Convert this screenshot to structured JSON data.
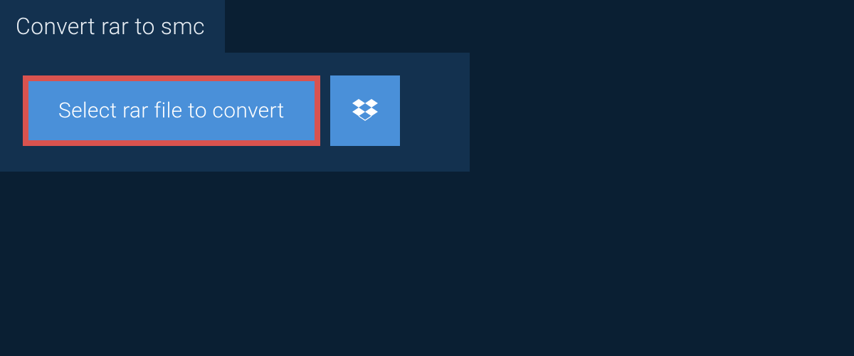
{
  "header": {
    "title": "Convert rar to smc"
  },
  "actions": {
    "select_file_label": "Select rar file to convert"
  }
}
